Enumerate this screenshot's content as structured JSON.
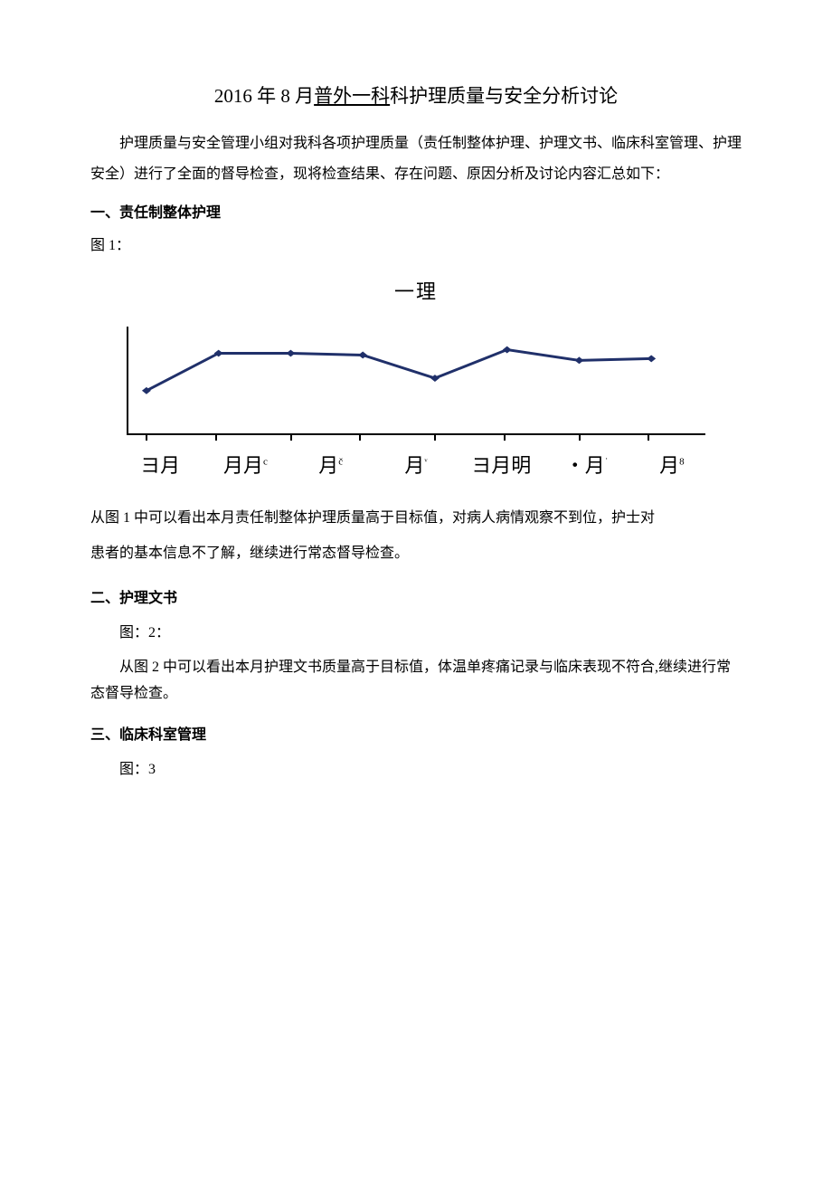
{
  "title_pre": "2016 年 8 月",
  "title_underline": "普外一科",
  "title_post": "科护理质量与安全分析讨论",
  "intro": "护理质量与安全管理小组对我科各项护理质量（责任制整体护理、护理文书、临床科室管理、护理安全）进行了全面的督导检查，现将检查结果、存在问题、原因分析及讨论内容汇总如下：",
  "section1_head": "一、责任制整体护理",
  "fig1_label": "图 1：",
  "chart_title": "一理",
  "section1_para1": "从图 1 中可以看出本月责任制整体护理质量高于目标值，对病人病情观察不到位，护士对",
  "section1_para2": "患者的基本信息不了解，继续进行常态督导检查。",
  "section2_head": "二、护理文书",
  "fig2_label": "图：2：",
  "section2_para": "从图 2 中可以看出本月护理文书质量高于目标值，体温单疼痛记录与临床表现不符合,继续进行常态督导检查。",
  "section3_head": "三、临床科室管理",
  "fig3_label": "图：3",
  "x_labels": [
    "ヨ月",
    "月月",
    "月",
    "月",
    "ヨ月明",
    "・月",
    "月"
  ],
  "x_sups": [
    "",
    "c",
    "č",
    "ᵛ",
    "",
    "˙",
    "8"
  ],
  "chart_data": {
    "type": "line",
    "categories": [
      "1月",
      "2月",
      "3月",
      "4月",
      "5月",
      "6月",
      "7月",
      "8月"
    ],
    "values": [
      60,
      80,
      80,
      79,
      65,
      83,
      77,
      78
    ],
    "title": "一理",
    "xlabel": "",
    "ylabel": "",
    "ylim": [
      0,
      100
    ]
  }
}
